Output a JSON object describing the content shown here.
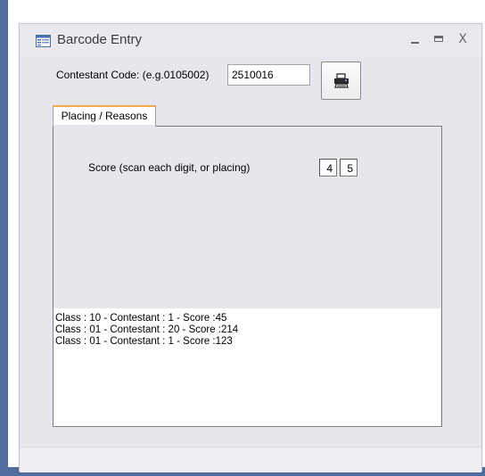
{
  "window": {
    "title": "Barcode Entry",
    "minimize_icon": "minimize-icon",
    "maximize_icon": "maximize-icon",
    "close_glyph": "X"
  },
  "form": {
    "contestant_code_label": "Contestant Code: (e.g.0105002)",
    "contestant_code_value": "2510016",
    "print_icon": "printer-icon"
  },
  "tabs": [
    {
      "label": "Placing / Reasons",
      "active": true
    }
  ],
  "score": {
    "label": "Score (scan each digit, or placing)",
    "digits": [
      "4",
      "5"
    ]
  },
  "results": [
    "Class : 10 - Contestant : 1 - Score :45",
    "Class : 01 - Contestant : 20 - Score :214",
    "Class : 01 - Contestant : 1 - Score :123"
  ],
  "colors": {
    "tab_accent": "#f2a74a",
    "window_bg": "#e8e5ec",
    "desktop_blue": "#4f6d9d"
  }
}
